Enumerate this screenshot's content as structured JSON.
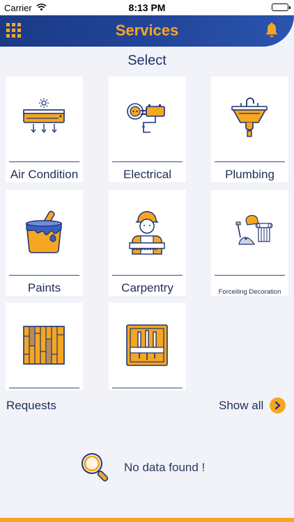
{
  "status_bar": {
    "carrier": "Carrier",
    "time": "8:13 PM"
  },
  "header": {
    "title": "Services"
  },
  "select_label": "Select",
  "services": [
    {
      "label": "Air Condition",
      "icon": "air-conditioner-icon"
    },
    {
      "label": "Electrical",
      "icon": "electrical-plug-icon"
    },
    {
      "label": "Plumbing",
      "icon": "sink-icon"
    },
    {
      "label": "Paints",
      "icon": "paint-bucket-icon"
    },
    {
      "label": "Carpentry",
      "icon": "carpenter-icon"
    },
    {
      "label": "Forceiling Decoration",
      "icon": "ceiling-decoration-icon"
    },
    {
      "label": "",
      "icon": "wood-flooring-icon"
    },
    {
      "label": "",
      "icon": "tools-box-icon"
    }
  ],
  "requests": {
    "title": "Requests",
    "show_all": "Show all"
  },
  "empty_state": {
    "message": "No data found !"
  },
  "colors": {
    "primary": "#1b3a86",
    "accent": "#f5a623",
    "background": "#f1f3f8"
  }
}
